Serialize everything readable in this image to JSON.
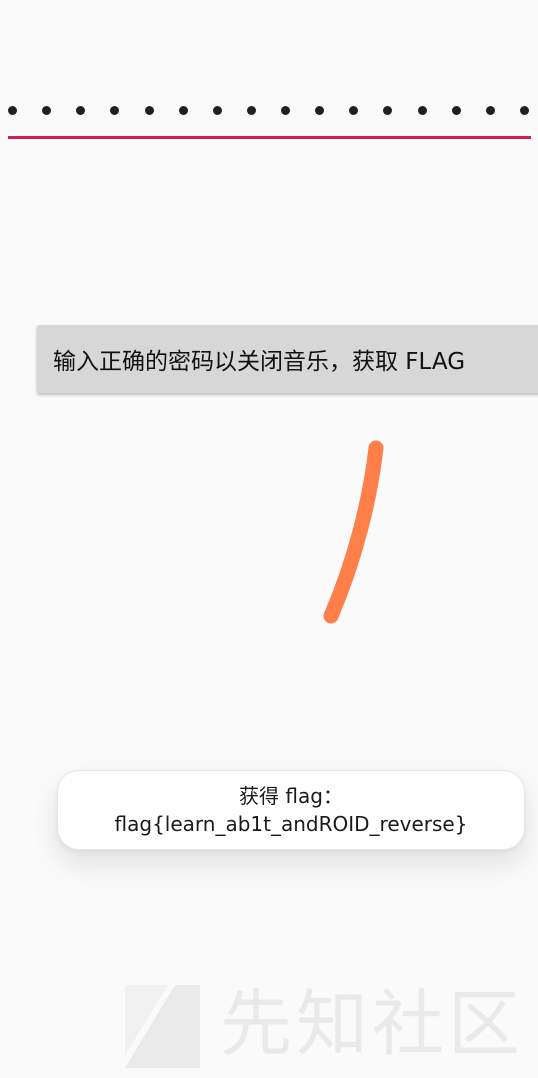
{
  "password_field": {
    "dot_count": 16,
    "underline_color": "#d01c5b",
    "dot_color": "#1f1f1f"
  },
  "action_button": {
    "label": "输入正确的密码以关闭音乐，获取 FLAG"
  },
  "stroke": {
    "color": "#ff7f4a"
  },
  "toast": {
    "line1": "获得 flag：",
    "line2": "flag{learn_ab1t_andROID_reverse}"
  },
  "watermark": {
    "text": "先知社区"
  }
}
